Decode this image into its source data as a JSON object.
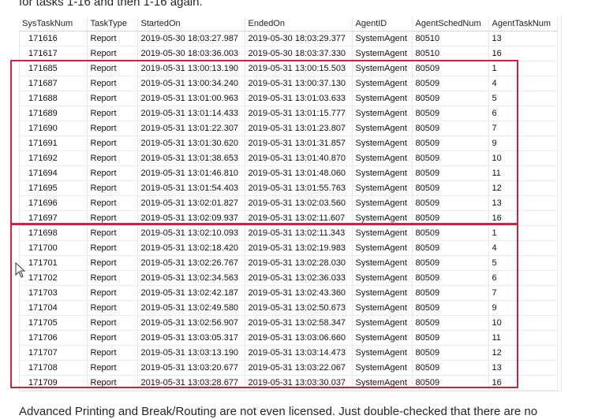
{
  "post": {
    "intro_text": "for tasks 1-16 and then 1-16 again.",
    "outro_text": "Advanced Printing and Break/Routing are not even licensed. Just double-checked that there are no"
  },
  "grid": {
    "columns": [
      "SysTaskNum",
      "TaskType",
      "StartedOn",
      "EndedOn",
      "AgentID",
      "AgentSchedNum",
      "AgentTaskNum"
    ],
    "rows": [
      [
        "171616",
        "Report",
        "2019-05-30 18:03:27.987",
        "2019-05-30 18:03:29.377",
        "SystemAgent",
        "80510",
        "13"
      ],
      [
        "171617",
        "Report",
        "2019-05-30 18:03:36.003",
        "2019-05-30 18:03:37.330",
        "SystemAgent",
        "80510",
        "16"
      ],
      [
        "171685",
        "Report",
        "2019-05-31 13:00:13.190",
        "2019-05-31 13:00:15.503",
        "SystemAgent",
        "80509",
        "1"
      ],
      [
        "171687",
        "Report",
        "2019-05-31 13:00:34.240",
        "2019-05-31 13:00:37.130",
        "SystemAgent",
        "80509",
        "4"
      ],
      [
        "171688",
        "Report",
        "2019-05-31 13:01:00.963",
        "2019-05-31 13:01:03.633",
        "SystemAgent",
        "80509",
        "5"
      ],
      [
        "171689",
        "Report",
        "2019-05-31 13:01:14.433",
        "2019-05-31 13:01:15.777",
        "SystemAgent",
        "80509",
        "6"
      ],
      [
        "171690",
        "Report",
        "2019-05-31 13:01:22.307",
        "2019-05-31 13:01:23.807",
        "SystemAgent",
        "80509",
        "7"
      ],
      [
        "171691",
        "Report",
        "2019-05-31 13:01:30.620",
        "2019-05-31 13:01:31.857",
        "SystemAgent",
        "80509",
        "9"
      ],
      [
        "171692",
        "Report",
        "2019-05-31 13:01:38.653",
        "2019-05-31 13:01:40.870",
        "SystemAgent",
        "80509",
        "10"
      ],
      [
        "171694",
        "Report",
        "2019-05-31 13:01:46.810",
        "2019-05-31 13:01:48.060",
        "SystemAgent",
        "80509",
        "11"
      ],
      [
        "171695",
        "Report",
        "2019-05-31 13:01:54.403",
        "2019-05-31 13:01:55.763",
        "SystemAgent",
        "80509",
        "12"
      ],
      [
        "171696",
        "Report",
        "2019-05-31 13:02:01.827",
        "2019-05-31 13:02:03.560",
        "SystemAgent",
        "80509",
        "13"
      ],
      [
        "171697",
        "Report",
        "2019-05-31 13:02:09.937",
        "2019-05-31 13:02:11.607",
        "SystemAgent",
        "80509",
        "16"
      ],
      [
        "171698",
        "Report",
        "2019-05-31 13:02:10.093",
        "2019-05-31 13:02:11.343",
        "SystemAgent",
        "80509",
        "1"
      ],
      [
        "171700",
        "Report",
        "2019-05-31 13:02:18.420",
        "2019-05-31 13:02:19.983",
        "SystemAgent",
        "80509",
        "4"
      ],
      [
        "171701",
        "Report",
        "2019-05-31 13:02:26.767",
        "2019-05-31 13:02:28.030",
        "SystemAgent",
        "80509",
        "5"
      ],
      [
        "171702",
        "Report",
        "2019-05-31 13:02:34.563",
        "2019-05-31 13:02:36.033",
        "SystemAgent",
        "80509",
        "6"
      ],
      [
        "171703",
        "Report",
        "2019-05-31 13:02:42.187",
        "2019-05-31 13:02:43.360",
        "SystemAgent",
        "80509",
        "7"
      ],
      [
        "171704",
        "Report",
        "2019-05-31 13:02:49.580",
        "2019-05-31 13:02:50.673",
        "SystemAgent",
        "80509",
        "9"
      ],
      [
        "171705",
        "Report",
        "2019-05-31 13:02:56.907",
        "2019-05-31 13:02:58.347",
        "SystemAgent",
        "80509",
        "10"
      ],
      [
        "171706",
        "Report",
        "2019-05-31 13:03:05.317",
        "2019-05-31 13:03:06.660",
        "SystemAgent",
        "80509",
        "11"
      ],
      [
        "171707",
        "Report",
        "2019-05-31 13:03:13.190",
        "2019-05-31 13:03:14.473",
        "SystemAgent",
        "80509",
        "12"
      ],
      [
        "171708",
        "Report",
        "2019-05-31 13:03:20.677",
        "2019-05-31 13:03:22.067",
        "SystemAgent",
        "80509",
        "13"
      ],
      [
        "171709",
        "Report",
        "2019-05-31 13:03:28.677",
        "2019-05-31 13:03:30.037",
        "SystemAgent",
        "80509",
        "16"
      ]
    ]
  },
  "highlight_color": "#d0203a",
  "cursor_icon": "mouse-pointer-icon"
}
